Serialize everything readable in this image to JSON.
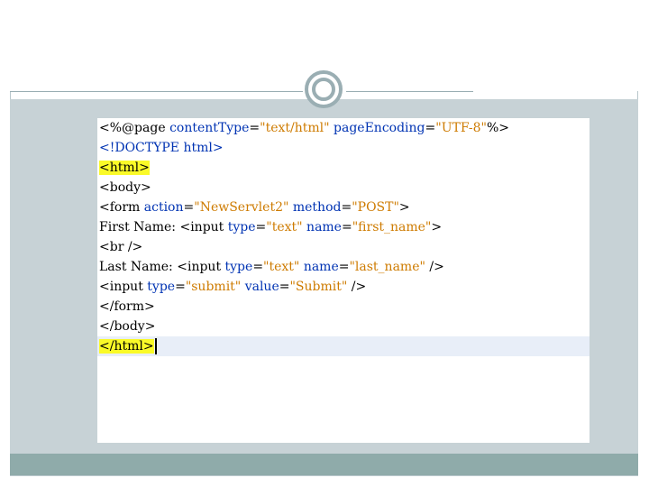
{
  "editor": {
    "lines": [
      {
        "tokens": [
          {
            "t": "<%@",
            "c": "kw"
          },
          {
            "t": "page",
            "c": "kw"
          },
          {
            "t": " ",
            "c": "kw"
          },
          {
            "t": "contentType",
            "c": "attr"
          },
          {
            "t": "=",
            "c": "kw"
          },
          {
            "t": "\"text/html\"",
            "c": "str"
          },
          {
            "t": " ",
            "c": "kw"
          },
          {
            "t": "pageEncoding",
            "c": "attr"
          },
          {
            "t": "=",
            "c": "kw"
          },
          {
            "t": "\"UTF-8\"",
            "c": "str"
          },
          {
            "t": "%>",
            "c": "kw"
          }
        ]
      },
      {
        "tokens": [
          {
            "t": "<!DOCTYPE html>",
            "c": "attr"
          }
        ]
      },
      {
        "tokens": [
          {
            "t": "<html>",
            "c": "hl"
          }
        ]
      },
      {
        "tokens": [
          {
            "t": "<body>",
            "c": "kw"
          }
        ]
      },
      {
        "tokens": [
          {
            "t": "<form ",
            "c": "kw"
          },
          {
            "t": "action",
            "c": "attr"
          },
          {
            "t": "=",
            "c": "kw"
          },
          {
            "t": "\"NewServlet2\"",
            "c": "str"
          },
          {
            "t": " ",
            "c": "kw"
          },
          {
            "t": "method",
            "c": "attr"
          },
          {
            "t": "=",
            "c": "kw"
          },
          {
            "t": "\"POST\"",
            "c": "str"
          },
          {
            "t": ">",
            "c": "kw"
          }
        ]
      },
      {
        "tokens": [
          {
            "t": "First Name: ",
            "c": "kw"
          },
          {
            "t": "<input ",
            "c": "kw"
          },
          {
            "t": "type",
            "c": "attr"
          },
          {
            "t": "=",
            "c": "kw"
          },
          {
            "t": "\"text\"",
            "c": "str"
          },
          {
            "t": " ",
            "c": "kw"
          },
          {
            "t": "name",
            "c": "attr"
          },
          {
            "t": "=",
            "c": "kw"
          },
          {
            "t": "\"first_name\"",
            "c": "str"
          },
          {
            "t": ">",
            "c": "kw"
          }
        ]
      },
      {
        "tokens": [
          {
            "t": "<br />",
            "c": "kw"
          }
        ]
      },
      {
        "tokens": [
          {
            "t": "Last Name: ",
            "c": "kw"
          },
          {
            "t": "<input ",
            "c": "kw"
          },
          {
            "t": "type",
            "c": "attr"
          },
          {
            "t": "=",
            "c": "kw"
          },
          {
            "t": "\"text\"",
            "c": "str"
          },
          {
            "t": " ",
            "c": "kw"
          },
          {
            "t": "name",
            "c": "attr"
          },
          {
            "t": "=",
            "c": "kw"
          },
          {
            "t": "\"last_name\"",
            "c": "str"
          },
          {
            "t": " />",
            "c": "kw"
          }
        ]
      },
      {
        "tokens": [
          {
            "t": "<input ",
            "c": "kw"
          },
          {
            "t": "type",
            "c": "attr"
          },
          {
            "t": "=",
            "c": "kw"
          },
          {
            "t": "\"submit\"",
            "c": "str"
          },
          {
            "t": " ",
            "c": "kw"
          },
          {
            "t": "value",
            "c": "attr"
          },
          {
            "t": "=",
            "c": "kw"
          },
          {
            "t": "\"Submit\"",
            "c": "str"
          },
          {
            "t": " />",
            "c": "kw"
          }
        ]
      },
      {
        "tokens": [
          {
            "t": "</form>",
            "c": "kw"
          }
        ]
      },
      {
        "tokens": [
          {
            "t": "</body>",
            "c": "kw"
          }
        ]
      },
      {
        "tokens": [
          {
            "t": "</html>",
            "c": "hl"
          }
        ],
        "current": true
      }
    ]
  }
}
